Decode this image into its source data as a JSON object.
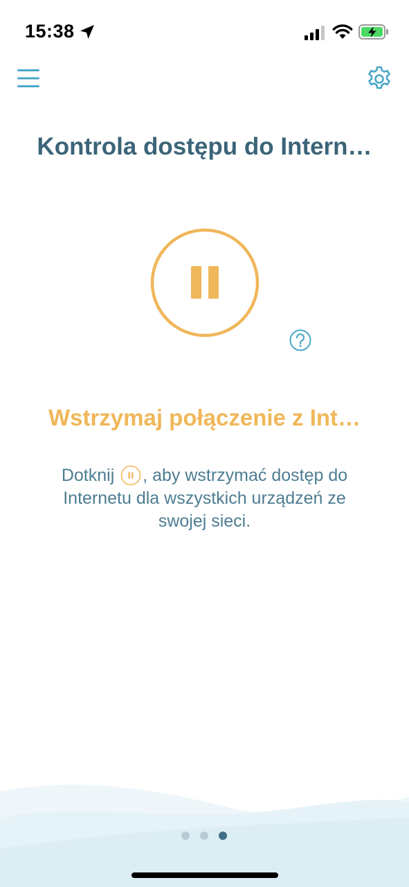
{
  "status_bar": {
    "time": "15:38"
  },
  "header": {
    "title": "Kontrola dostępu do Intern…"
  },
  "pause_section": {
    "subtitle": "Wstrzymaj połączenie z Int…",
    "description_before": "Dotknij",
    "description_after": ", aby wstrzymać dostęp do Internetu dla wszystkich urządzeń ze swojej sieci."
  },
  "pager": {
    "total": 3,
    "active": 3
  },
  "colors": {
    "title": "#3b6478",
    "accent_orange": "#f0b75a",
    "icon_blue": "#4aa8c8",
    "description": "#4d7d91"
  },
  "icons": {
    "menu": "hamburger-icon",
    "settings": "gear-icon",
    "pause": "pause-icon",
    "help": "question-icon"
  }
}
